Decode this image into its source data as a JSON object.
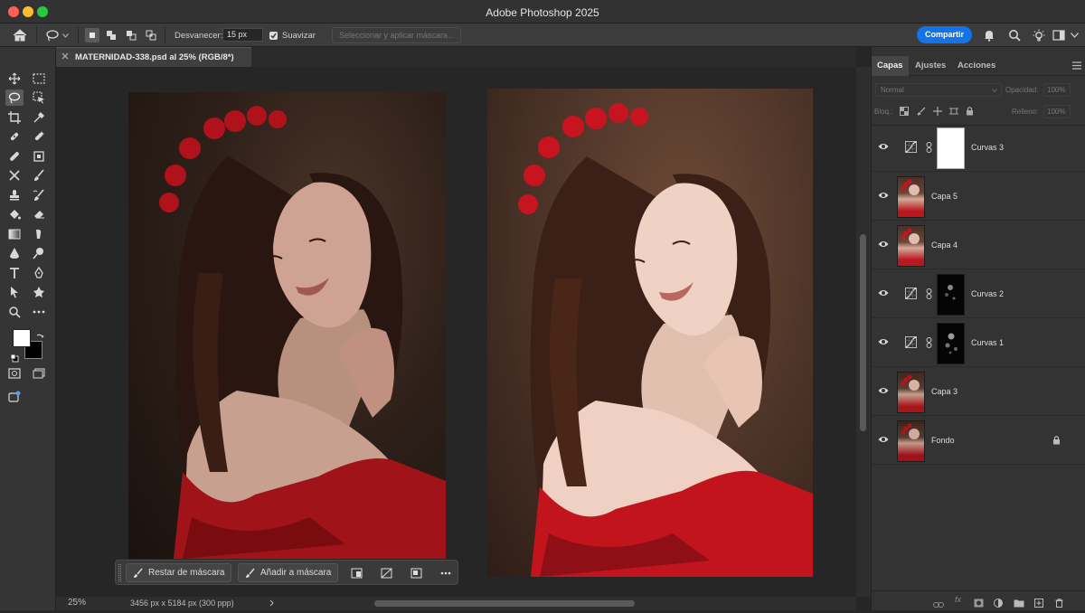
{
  "window": {
    "title": "Adobe Photoshop 2025"
  },
  "options_bar": {
    "feather_label": "Desvanecer:",
    "feather_value": "15 px",
    "antialias_label": "Suavizar",
    "select_mask_label": "Seleccionar y aplicar máscara...",
    "share_label": "Compartir"
  },
  "document": {
    "tab_title": "MATERNIDAD-338.psd al 25% (RGB/8*)",
    "zoom": "25%",
    "info": "3456 px x 5184 px (300 ppp)"
  },
  "context_bar": {
    "subtract_mask_label": "Restar de máscara",
    "add_mask_label": "Añadir a máscara"
  },
  "layers_panel": {
    "tabs": [
      "Capas",
      "Ajustes",
      "Acciones"
    ],
    "blend_mode": "Normal",
    "opacity_label": "Opacidad:",
    "opacity_value": "100%",
    "lock_label": "Bloq.:",
    "fill_label": "Relleno:",
    "fill_value": "100%",
    "layers": [
      {
        "name": "Curvas 3",
        "type": "curves",
        "mask": "white"
      },
      {
        "name": "Capa 5",
        "type": "pixel"
      },
      {
        "name": "Capa 4",
        "type": "pixel"
      },
      {
        "name": "Curvas 2",
        "type": "curves",
        "mask": "dark"
      },
      {
        "name": "Curvas 1",
        "type": "curves",
        "mask": "dark"
      },
      {
        "name": "Capa 3",
        "type": "pixel"
      },
      {
        "name": "Fondo",
        "type": "pixel",
        "locked": true
      }
    ]
  },
  "colors": {
    "accent": "#1473e6",
    "foreground": "#ffffff",
    "background": "#000000"
  }
}
